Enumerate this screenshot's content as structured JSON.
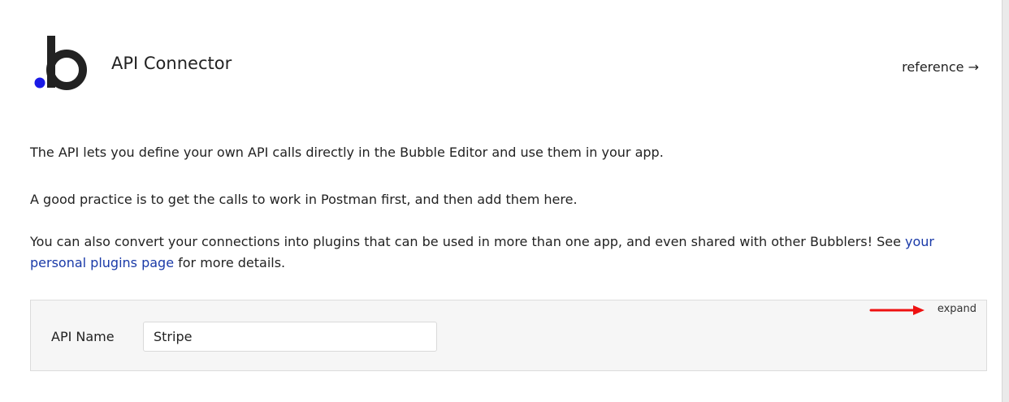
{
  "header": {
    "title": "API Connector",
    "reference_label": "reference →",
    "logo_icon": "bubble-logo-icon",
    "logo_dot_color": "#1a1ae6"
  },
  "description": {
    "paragraph_1": "The API lets you define your own API calls directly in the Bubble Editor and use them in your app.",
    "paragraph_2": "A good practice is to get the calls to work in Postman first, and then add them here.",
    "paragraph_3_before_link": "You can also convert your connections into plugins that can be used in more than one app, and even shared with other Bubblers! See ",
    "paragraph_3_link": "your personal plugins page",
    "paragraph_3_after_link": " for more details.",
    "link_color": "#1a3aa8"
  },
  "api_panel": {
    "expand_label": "expand",
    "arrow_color": "#ee1111",
    "api_name_label": "API Name",
    "api_name_value": "Stripe"
  }
}
